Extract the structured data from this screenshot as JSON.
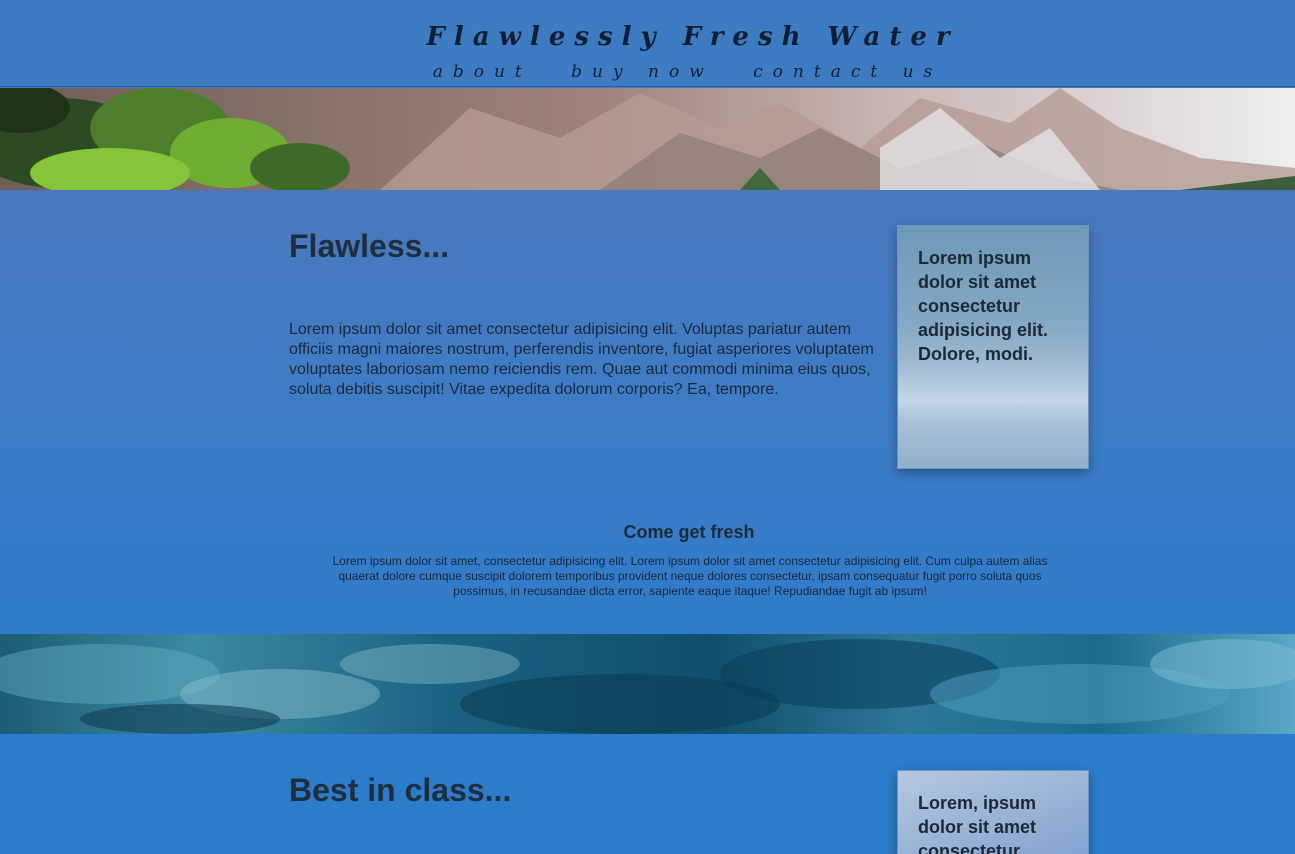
{
  "header": {
    "title": "Flawlessly Fresh Water",
    "nav": [
      "about",
      "buy now",
      "contact us"
    ]
  },
  "section1": {
    "heading": "Flawless...",
    "body": "Lorem ipsum dolor sit amet consectetur adipisicing elit. Voluptas pariatur autem officiis magni maiores nostrum, perferendis inventore, fugiat asperiores voluptatem voluptates laboriosam nemo reiciendis rem. Quae aut commodi minima eius quos, soluta debitis suscipit! Vitae expedita dolorum corporis? Ea, tempore.",
    "card_text": "Lorem ipsum dolor sit amet consectetur adipisicing elit. Dolore, modi."
  },
  "promo": {
    "heading": "Come get fresh",
    "body": "Lorem ipsum dolor sit amet, consectetur adipisicing elit. Lorem ipsum dolor sit amet consectetur adipisicing elit. Cum culpa autem alias quaerat dolore cumque suscipit dolorem temporibus provident neque dolores consectetur, ipsam consequatur fugit porro soluta quos possimus, in recusandae dicta error, sapiente eaque itaque! Repudiandae fugit ab ipsum!"
  },
  "section2": {
    "heading": "Best in class...",
    "card_text": "Lorem, ipsum dolor sit amet consectetur"
  },
  "colors": {
    "header_bg": "#3d7cc2",
    "page_bg": "#3a7cc4",
    "text_dark": "#1d2b3a"
  }
}
